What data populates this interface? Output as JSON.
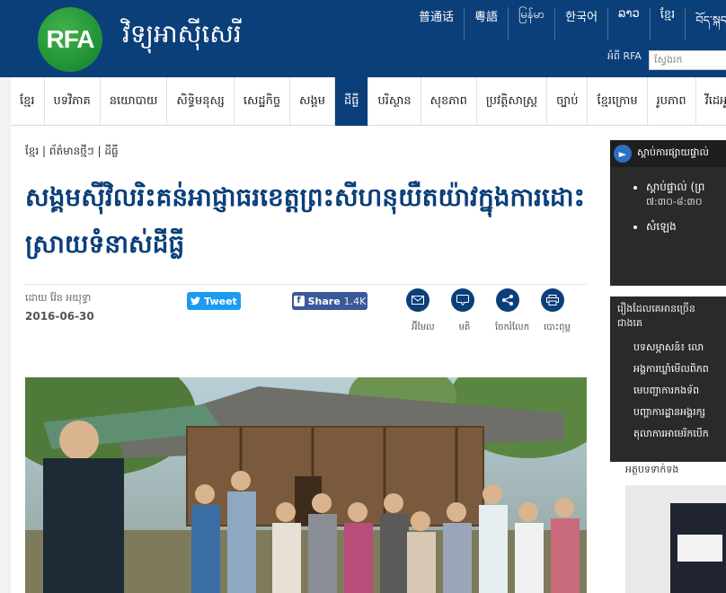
{
  "header": {
    "logo_text": "RFA",
    "site_name": "វិទ្យុអាស៊ីសេរី",
    "languages": [
      "普通话",
      "粵語",
      "မြန်မာ",
      "한국어",
      "ລາວ",
      "ខ្មែរ",
      "བོད་སྐད།"
    ],
    "about_label": "អំពី RFA",
    "search_placeholder": "ស្វែងរក"
  },
  "nav": {
    "items": [
      "ខ្មែរ",
      "បទវិភាគ",
      "នយោបាយ",
      "សិទ្ធិមនុស្ស",
      "សេដ្ឋកិច្ច",
      "សង្គម",
      "ដីធ្លី",
      "បរិស្ថាន",
      "សុខភាព",
      "ប្រវត្តិសាស្ត្រ",
      "ច្បាប់",
      "ខ្មែរក្រោម",
      "រូបភាព",
      "វីដេអូ"
    ],
    "active_index": 6
  },
  "article": {
    "breadcrumb": "ខ្មែរ | ព័ត៌មានថ្មីៗ | ដីធ្លី",
    "title": "សង្គមស៊ីវិលរិះគន់អាជ្ញាធរខេត្តព្រះសីហនុយឺតយ៉ាវក្នុងការដោះស្រាយទំនាស់ដីធ្លី",
    "byline": "ដោយ វ៉ែន អយុទ្ធា",
    "date": "2016-06-30",
    "tweet_label": "Tweet",
    "share_label": "Share",
    "share_count": "1.4K",
    "share_actions": [
      "អ៊ីមែល",
      "មតិ",
      "ចែករំលែក",
      "បោះពុម្ព"
    ]
  },
  "sidebar": {
    "listen_title": "ស្ដាប់ការផ្សាយផ្ទាល់",
    "listen_items": [
      {
        "label": "ស្ដាប់ផ្ទាល់ (ព្រ",
        "sub": "៧:៣០-៨:៣០"
      },
      {
        "label": "សំឡេង",
        "sub": ""
      }
    ],
    "popular_title": "រឿងដែលគេអានច្រើនជាងគេ",
    "popular_items": [
      "បទសម្ភាសន៍៖ លោ",
      "អង្គការឃ្លាំមើលពិភព",
      "មេបញ្ជាការកងទ័ព",
      "បញ្ហាការដ្ឋានអង្គរក្ស",
      "តុលាការអាមេរិកបើក"
    ],
    "bottom_label": "អត្ថបទទាក់ទង"
  },
  "colors": {
    "brand_blue": "#0b3f7a",
    "logo_green": "#1f8f35",
    "twitter": "#1d9bf0",
    "facebook": "#3b5998",
    "sidebar_dark": "#2a2a2a"
  }
}
